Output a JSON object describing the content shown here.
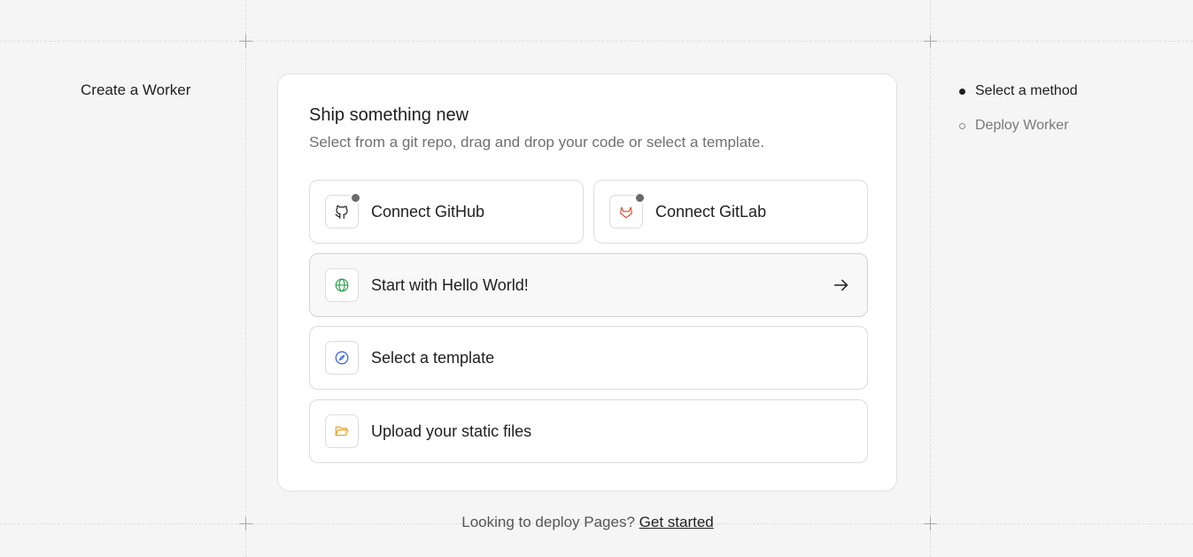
{
  "sidebar": {
    "title": "Create a Worker"
  },
  "card": {
    "title": "Ship something new",
    "subtitle": "Select from a git repo, drag and drop your code or select a template.",
    "options": [
      {
        "label": "Connect GitHub",
        "icon": "github-icon"
      },
      {
        "label": "Connect GitLab",
        "icon": "gitlab-icon"
      },
      {
        "label": "Start with Hello World!",
        "icon": "globe-icon"
      },
      {
        "label": "Select a template",
        "icon": "compass-icon"
      },
      {
        "label": "Upload your static files",
        "icon": "folder-open-icon"
      }
    ]
  },
  "steps": [
    {
      "label": "Select a method",
      "state": "active"
    },
    {
      "label": "Deploy Worker",
      "state": "inactive"
    }
  ],
  "footer": {
    "text": "Looking to deploy Pages?",
    "link": "Get started"
  },
  "colors": {
    "globe": "#2fa44f",
    "compass": "#2f5fdc",
    "folder": "#f0a020",
    "gitlab": "#e2532d"
  }
}
